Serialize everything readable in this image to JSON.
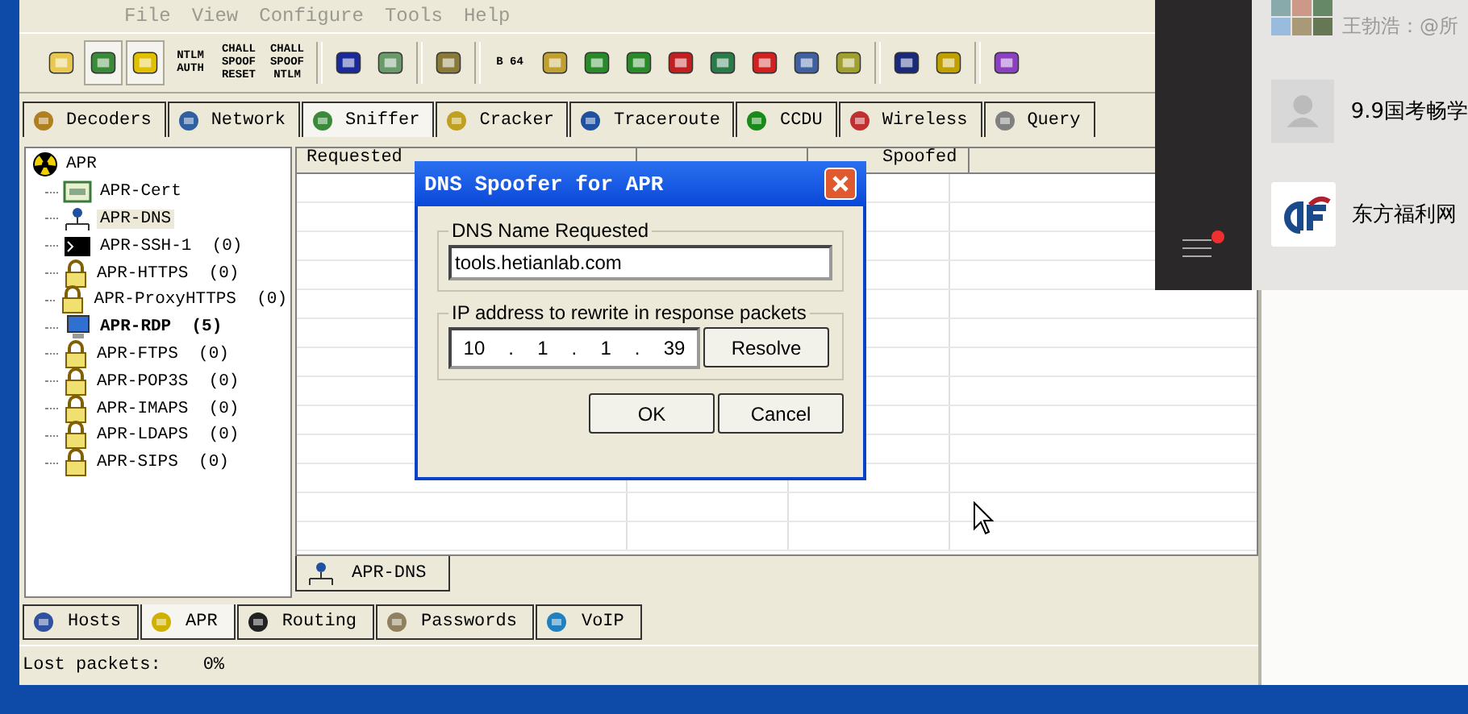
{
  "menu": [
    {
      "label": "File",
      "disabled": true
    },
    {
      "label": "View",
      "disabled": true
    },
    {
      "label": "Configure",
      "disabled": true
    },
    {
      "label": "Tools",
      "disabled": true
    },
    {
      "label": "Help",
      "disabled": true
    }
  ],
  "toolbar": [
    {
      "kind": "icon",
      "pressed": false
    },
    {
      "kind": "icon",
      "pressed": true
    },
    {
      "kind": "icon",
      "pressed": true
    },
    {
      "kind": "text",
      "label": "NTLM AUTH"
    },
    {
      "kind": "text",
      "label": "CHALL SPOOF RESET"
    },
    {
      "kind": "text",
      "label": "CHALL SPOOF NTLM"
    },
    {
      "kind": "sep"
    },
    {
      "kind": "icon",
      "pressed": false
    },
    {
      "kind": "icon",
      "pressed": false
    },
    {
      "kind": "sep"
    },
    {
      "kind": "icon",
      "pressed": false
    },
    {
      "kind": "sep"
    },
    {
      "kind": "text",
      "label": "B 64"
    },
    {
      "kind": "icon",
      "pressed": false
    },
    {
      "kind": "icon",
      "pressed": false
    },
    {
      "kind": "icon",
      "pressed": false
    },
    {
      "kind": "icon",
      "pressed": false
    },
    {
      "kind": "icon",
      "pressed": false
    },
    {
      "kind": "icon",
      "pressed": false
    },
    {
      "kind": "icon",
      "pressed": false
    },
    {
      "kind": "icon",
      "pressed": false
    },
    {
      "kind": "sep"
    },
    {
      "kind": "icon",
      "pressed": false
    },
    {
      "kind": "icon",
      "pressed": false
    },
    {
      "kind": "sep"
    },
    {
      "kind": "icon",
      "pressed": false
    }
  ],
  "tabs": [
    {
      "label": "Decoders",
      "selected": false
    },
    {
      "label": "Network",
      "selected": false
    },
    {
      "label": "Sniffer",
      "selected": true
    },
    {
      "label": "Cracker",
      "selected": false
    },
    {
      "label": "Traceroute",
      "selected": false
    },
    {
      "label": "CCDU",
      "selected": false
    },
    {
      "label": "Wireless",
      "selected": false
    },
    {
      "label": "Query",
      "selected": false
    }
  ],
  "tree": {
    "label": "APR",
    "children": [
      {
        "kind": "cert",
        "label": "APR-Cert",
        "selected": false,
        "bold": false
      },
      {
        "kind": "network",
        "label": "APR-DNS",
        "selected": true,
        "bold": false
      },
      {
        "kind": "terminal",
        "label": "APR-SSH-1",
        "count": "(0)",
        "selected": false,
        "bold": false
      },
      {
        "kind": "lock",
        "label": "APR-HTTPS",
        "count": "(0)",
        "selected": false,
        "bold": false
      },
      {
        "kind": "lock",
        "label": "APR-ProxyHTTPS",
        "count": "(0)",
        "selected": false,
        "bold": false
      },
      {
        "kind": "monitor",
        "label": "APR-RDP",
        "count": "(5)",
        "selected": false,
        "bold": true
      },
      {
        "kind": "lock",
        "label": "APR-FTPS",
        "count": "(0)",
        "selected": false,
        "bold": false
      },
      {
        "kind": "lock",
        "label": "APR-POP3S",
        "count": "(0)",
        "selected": false,
        "bold": false
      },
      {
        "kind": "lock",
        "label": "APR-IMAPS",
        "count": "(0)",
        "selected": false,
        "bold": false
      },
      {
        "kind": "lock",
        "label": "APR-LDAPS",
        "count": "(0)",
        "selected": false,
        "bold": false
      },
      {
        "kind": "lock",
        "label": "APR-SIPS",
        "count": "(0)",
        "selected": false,
        "bold": false
      }
    ]
  },
  "table": {
    "columns": [
      "Requested",
      "Spoofed"
    ]
  },
  "subtabs": [
    "APR-DNS"
  ],
  "bottom_tabs": [
    {
      "label": "Hosts",
      "selected": false
    },
    {
      "label": "APR",
      "selected": true
    },
    {
      "label": "Routing",
      "selected": false
    },
    {
      "label": "Passwords",
      "selected": false
    },
    {
      "label": "VoIP",
      "selected": false
    }
  ],
  "status_bar": {
    "label": "Lost packets:",
    "value": "0%"
  },
  "dialog": {
    "title": "DNS Spoofer for APR",
    "name_group": "DNS Name Requested",
    "name_value": "tools.hetianlab.com",
    "ip_group": "IP address to rewrite in response packets",
    "ip": [
      "10",
      "1",
      "1",
      "39"
    ],
    "ip_separator": ".",
    "buttons": [
      "Resolve",
      "OK",
      "Cancel"
    ]
  },
  "chat": {
    "items": [
      {
        "kind": "group",
        "preview": "王勃浩：@所"
      },
      {
        "kind": "placeholder",
        "name": "9.9国考畅学"
      },
      {
        "kind": "logo",
        "name": "东方福利网"
      }
    ],
    "unread": true
  }
}
